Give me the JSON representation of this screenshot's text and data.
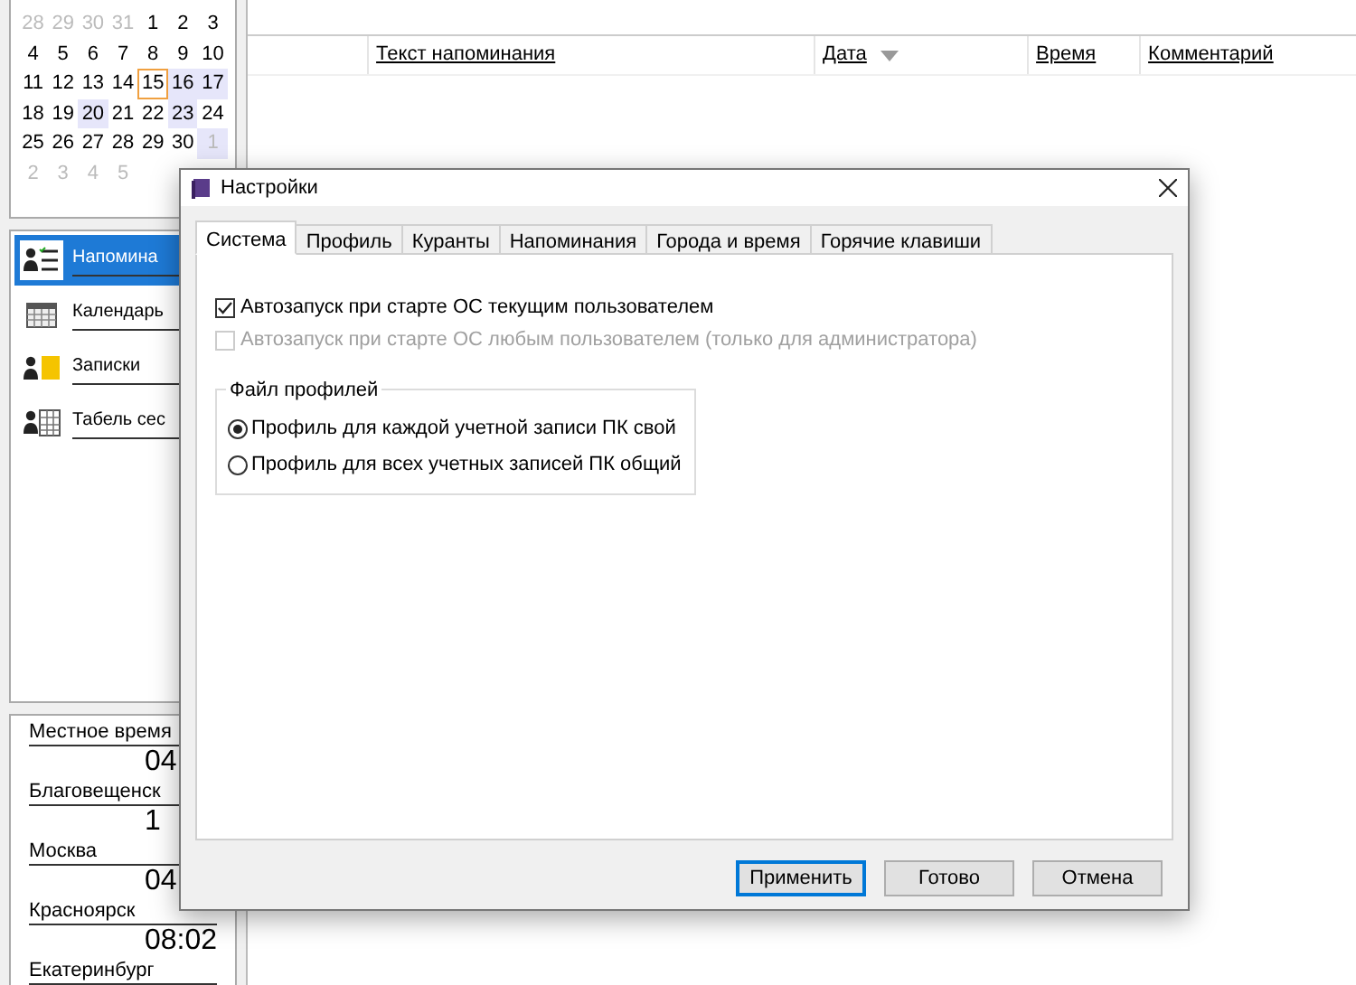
{
  "calendar": {
    "weeks": [
      [
        {
          "day": "28",
          "muted": true,
          "marked": false,
          "today": false
        },
        {
          "day": "29",
          "muted": true,
          "marked": false,
          "today": false
        },
        {
          "day": "30",
          "muted": true,
          "marked": false,
          "today": false
        },
        {
          "day": "31",
          "muted": true,
          "marked": false,
          "today": false
        },
        {
          "day": "1",
          "muted": false,
          "marked": false,
          "today": false
        },
        {
          "day": "2",
          "muted": false,
          "marked": false,
          "today": false
        },
        {
          "day": "3",
          "muted": false,
          "marked": false,
          "today": false
        }
      ],
      [
        {
          "day": "4",
          "muted": false,
          "marked": false,
          "today": false
        },
        {
          "day": "5",
          "muted": false,
          "marked": false,
          "today": false
        },
        {
          "day": "6",
          "muted": false,
          "marked": false,
          "today": false
        },
        {
          "day": "7",
          "muted": false,
          "marked": false,
          "today": false
        },
        {
          "day": "8",
          "muted": false,
          "marked": false,
          "today": false
        },
        {
          "day": "9",
          "muted": false,
          "marked": false,
          "today": false
        },
        {
          "day": "10",
          "muted": false,
          "marked": false,
          "today": false
        }
      ],
      [
        {
          "day": "11",
          "muted": false,
          "marked": false,
          "today": false
        },
        {
          "day": "12",
          "muted": false,
          "marked": false,
          "today": false
        },
        {
          "day": "13",
          "muted": false,
          "marked": false,
          "today": false
        },
        {
          "day": "14",
          "muted": false,
          "marked": false,
          "today": false
        },
        {
          "day": "15",
          "muted": false,
          "marked": false,
          "today": true
        },
        {
          "day": "16",
          "muted": false,
          "marked": true,
          "today": false
        },
        {
          "day": "17",
          "muted": false,
          "marked": true,
          "today": false
        }
      ],
      [
        {
          "day": "18",
          "muted": false,
          "marked": false,
          "today": false
        },
        {
          "day": "19",
          "muted": false,
          "marked": false,
          "today": false
        },
        {
          "day": "20",
          "muted": false,
          "marked": true,
          "today": false
        },
        {
          "day": "21",
          "muted": false,
          "marked": false,
          "today": false
        },
        {
          "day": "22",
          "muted": false,
          "marked": false,
          "today": false
        },
        {
          "day": "23",
          "muted": false,
          "marked": true,
          "today": false
        },
        {
          "day": "24",
          "muted": false,
          "marked": false,
          "today": false
        }
      ],
      [
        {
          "day": "25",
          "muted": false,
          "marked": false,
          "today": false
        },
        {
          "day": "26",
          "muted": false,
          "marked": false,
          "today": false
        },
        {
          "day": "27",
          "muted": false,
          "marked": false,
          "today": false
        },
        {
          "day": "28",
          "muted": false,
          "marked": false,
          "today": false
        },
        {
          "day": "29",
          "muted": false,
          "marked": false,
          "today": false
        },
        {
          "day": "30",
          "muted": false,
          "marked": false,
          "today": false
        },
        {
          "day": "1",
          "muted": true,
          "marked": true,
          "today": false
        }
      ],
      [
        {
          "day": "2",
          "muted": true,
          "marked": false,
          "today": false
        },
        {
          "day": "3",
          "muted": true,
          "marked": false,
          "today": false
        },
        {
          "day": "4",
          "muted": true,
          "marked": false,
          "today": false
        },
        {
          "day": "5",
          "muted": true,
          "marked": false,
          "today": false
        }
      ]
    ]
  },
  "sidebar": {
    "items": [
      {
        "label": "Напомина",
        "kind": "reminders",
        "selected": true
      },
      {
        "label": "Календарь",
        "kind": "calendar",
        "selected": false
      },
      {
        "label": "Записки",
        "kind": "notes",
        "selected": false
      },
      {
        "label": "Табель сес",
        "kind": "timesheet",
        "selected": false
      }
    ]
  },
  "clocks": [
    {
      "city": "Местное время",
      "time": "04"
    },
    {
      "city": "Благовещенск",
      "time": "1"
    },
    {
      "city": "Москва",
      "time": "04"
    },
    {
      "city": "Красноярск",
      "time": "08:02"
    },
    {
      "city": "Екатеринбург"
    }
  ],
  "table": {
    "columns": [
      {
        "label": "Текст напоминания",
        "sorted": false
      },
      {
        "label": "Дата",
        "sorted": true
      },
      {
        "label": "Время",
        "sorted": false
      },
      {
        "label": "Комментарий",
        "sorted": false
      }
    ]
  },
  "dialog": {
    "title": "Настройки",
    "tabs": [
      {
        "label": "Система",
        "selected": true
      },
      {
        "label": "Профиль",
        "selected": false
      },
      {
        "label": "Куранты",
        "selected": false
      },
      {
        "label": "Напоминания",
        "selected": false
      },
      {
        "label": "Города и время",
        "selected": false
      },
      {
        "label": "Горячие клавиши",
        "selected": false
      }
    ],
    "checkboxes": [
      {
        "label": "Автозапуск при старте ОС текущим пользователем",
        "checked": true,
        "disabled": false
      },
      {
        "label": "Автозапуск при старте ОС любым пользователем (только для администратора)",
        "checked": false,
        "disabled": true
      }
    ],
    "group": {
      "title": "Файл профилей",
      "options": [
        {
          "label": "Профиль для каждой учетной записи ПК свой",
          "selected": true
        },
        {
          "label": "Профиль для всех учетных записей ПК общий",
          "selected": false
        }
      ]
    },
    "buttons": [
      {
        "label": "Применить",
        "default": true
      },
      {
        "label": "Готово",
        "default": false
      },
      {
        "label": "Отмена",
        "default": false
      }
    ]
  }
}
